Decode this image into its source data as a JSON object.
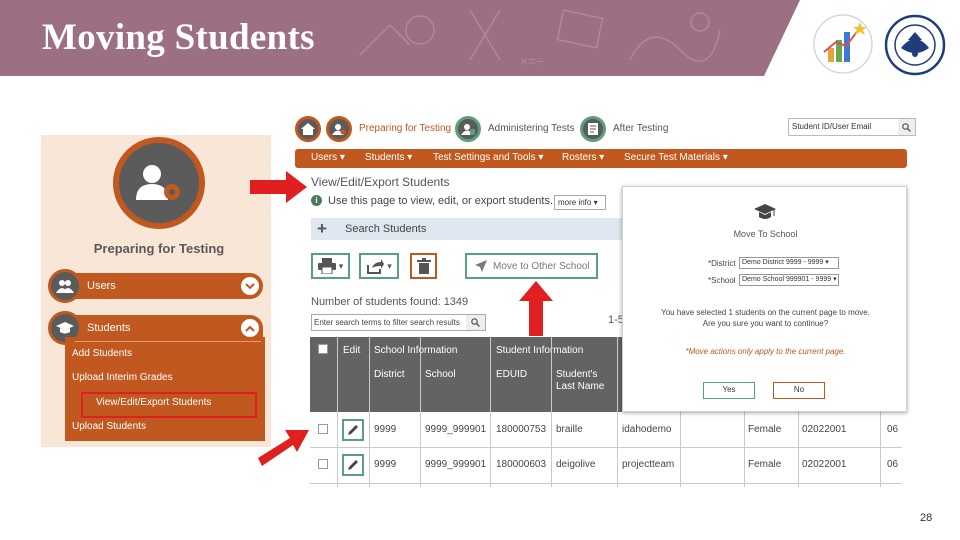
{
  "slide": {
    "title": "Moving Students",
    "page_number": "28"
  },
  "left_panel": {
    "heading": "Preparing for Testing",
    "users_label": "Users",
    "students_label": "Students",
    "items": [
      "Add Students",
      "Upload Interim Grades",
      "View/Edit/Export Students",
      "Upload Students"
    ]
  },
  "top_nav": {
    "preparing": "Preparing for Testing",
    "administering": "Administering Tests",
    "after": "After Testing",
    "search_placeholder": "Student ID/User Email"
  },
  "menu": [
    "Users",
    "Students",
    "Test Settings and Tools",
    "Rosters",
    "Secure Test Materials"
  ],
  "page": {
    "title": "View/Edit/Export Students",
    "info_text": "Use this page to view, edit, or export students.",
    "more_info": "more info",
    "search_header": "Search Students",
    "move_button": "Move to Other School",
    "count_text": "Number of students found: 1349",
    "filter_placeholder": "Enter search terms to filter search results",
    "range_text": "1-5"
  },
  "table": {
    "group_headers": {
      "edit": "Edit",
      "school_info": "School Information",
      "student_info": "Student Information"
    },
    "col_headers": {
      "district": "District",
      "school": "School",
      "eduid": "EDUID",
      "last_name": "Student's Last Name"
    },
    "rows": [
      {
        "district": "9999",
        "school": "9999_999901",
        "eduid": "180000753",
        "last": "braille",
        "first": "idahodemo",
        "gender": "Female",
        "dob": "02022001",
        "grade": "06"
      },
      {
        "district": "9999",
        "school": "9999_999901",
        "eduid": "180000603",
        "last": "deigolive",
        "first": "projectteam",
        "gender": "Female",
        "dob": "02022001",
        "grade": "06"
      }
    ]
  },
  "modal": {
    "title": "Move To School",
    "district_label": "*District",
    "district_value": "Demo District 9999 - 9999",
    "school_label": "*School",
    "school_value": "Demo School 999901 - 9999",
    "message_line1": "You have selected 1 students on the current page to move.",
    "message_line2": "Are you sure you want to continue?",
    "note": "*Move actions only apply to the current page.",
    "yes": "Yes",
    "no": "No"
  },
  "colors": {
    "banner": "#9c6f84",
    "orange": "#c1581f",
    "green": "#5aa17b",
    "arrow_red": "#e02020"
  }
}
